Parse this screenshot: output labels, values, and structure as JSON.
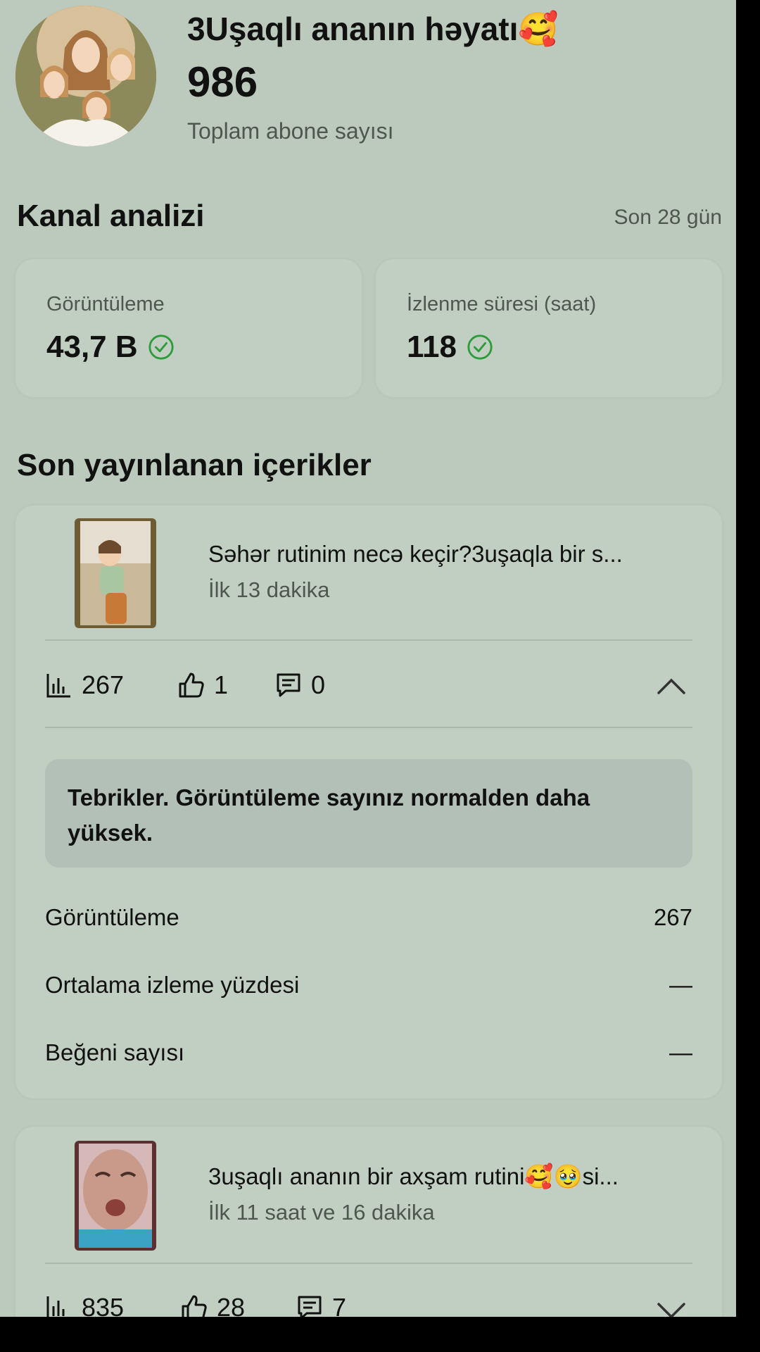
{
  "header": {
    "channel_name": "3Uşaqlı ananın həyatı🥰",
    "subscriber_count": "986",
    "subscriber_label": "Toplam abone sayısı"
  },
  "analysis": {
    "title": "Kanal analizi",
    "period": "Son 28 gün",
    "views_label": "Görüntüleme",
    "views_value": "43,7 B",
    "watch_label": "İzlenme süresi (saat)",
    "watch_value": "118"
  },
  "recent": {
    "title": "Son yayınlanan içerikler",
    "videos": [
      {
        "title": "Səhər rutinim necə keçir?3uşaqla bir s...",
        "time": "İlk 13 dakika",
        "views": "267",
        "likes": "1",
        "comments": "0",
        "notice": "Tebrikler. Görüntüleme sayınız normalden daha yüksek.",
        "details": [
          {
            "label": "Görüntüleme",
            "value": "267"
          },
          {
            "label": "Ortalama izleme yüzdesi",
            "value": "—"
          },
          {
            "label": "Beğeni sayısı",
            "value": "—"
          }
        ]
      },
      {
        "title": "3uşaqlı ananın bir axşam rutini🥰🥹si...",
        "time": "İlk 11 saat ve 16 dakika",
        "views": "835",
        "likes": "28",
        "comments": "7"
      }
    ]
  },
  "colors": {
    "background": "#bccabd",
    "check_green": "#2e9b3a"
  }
}
